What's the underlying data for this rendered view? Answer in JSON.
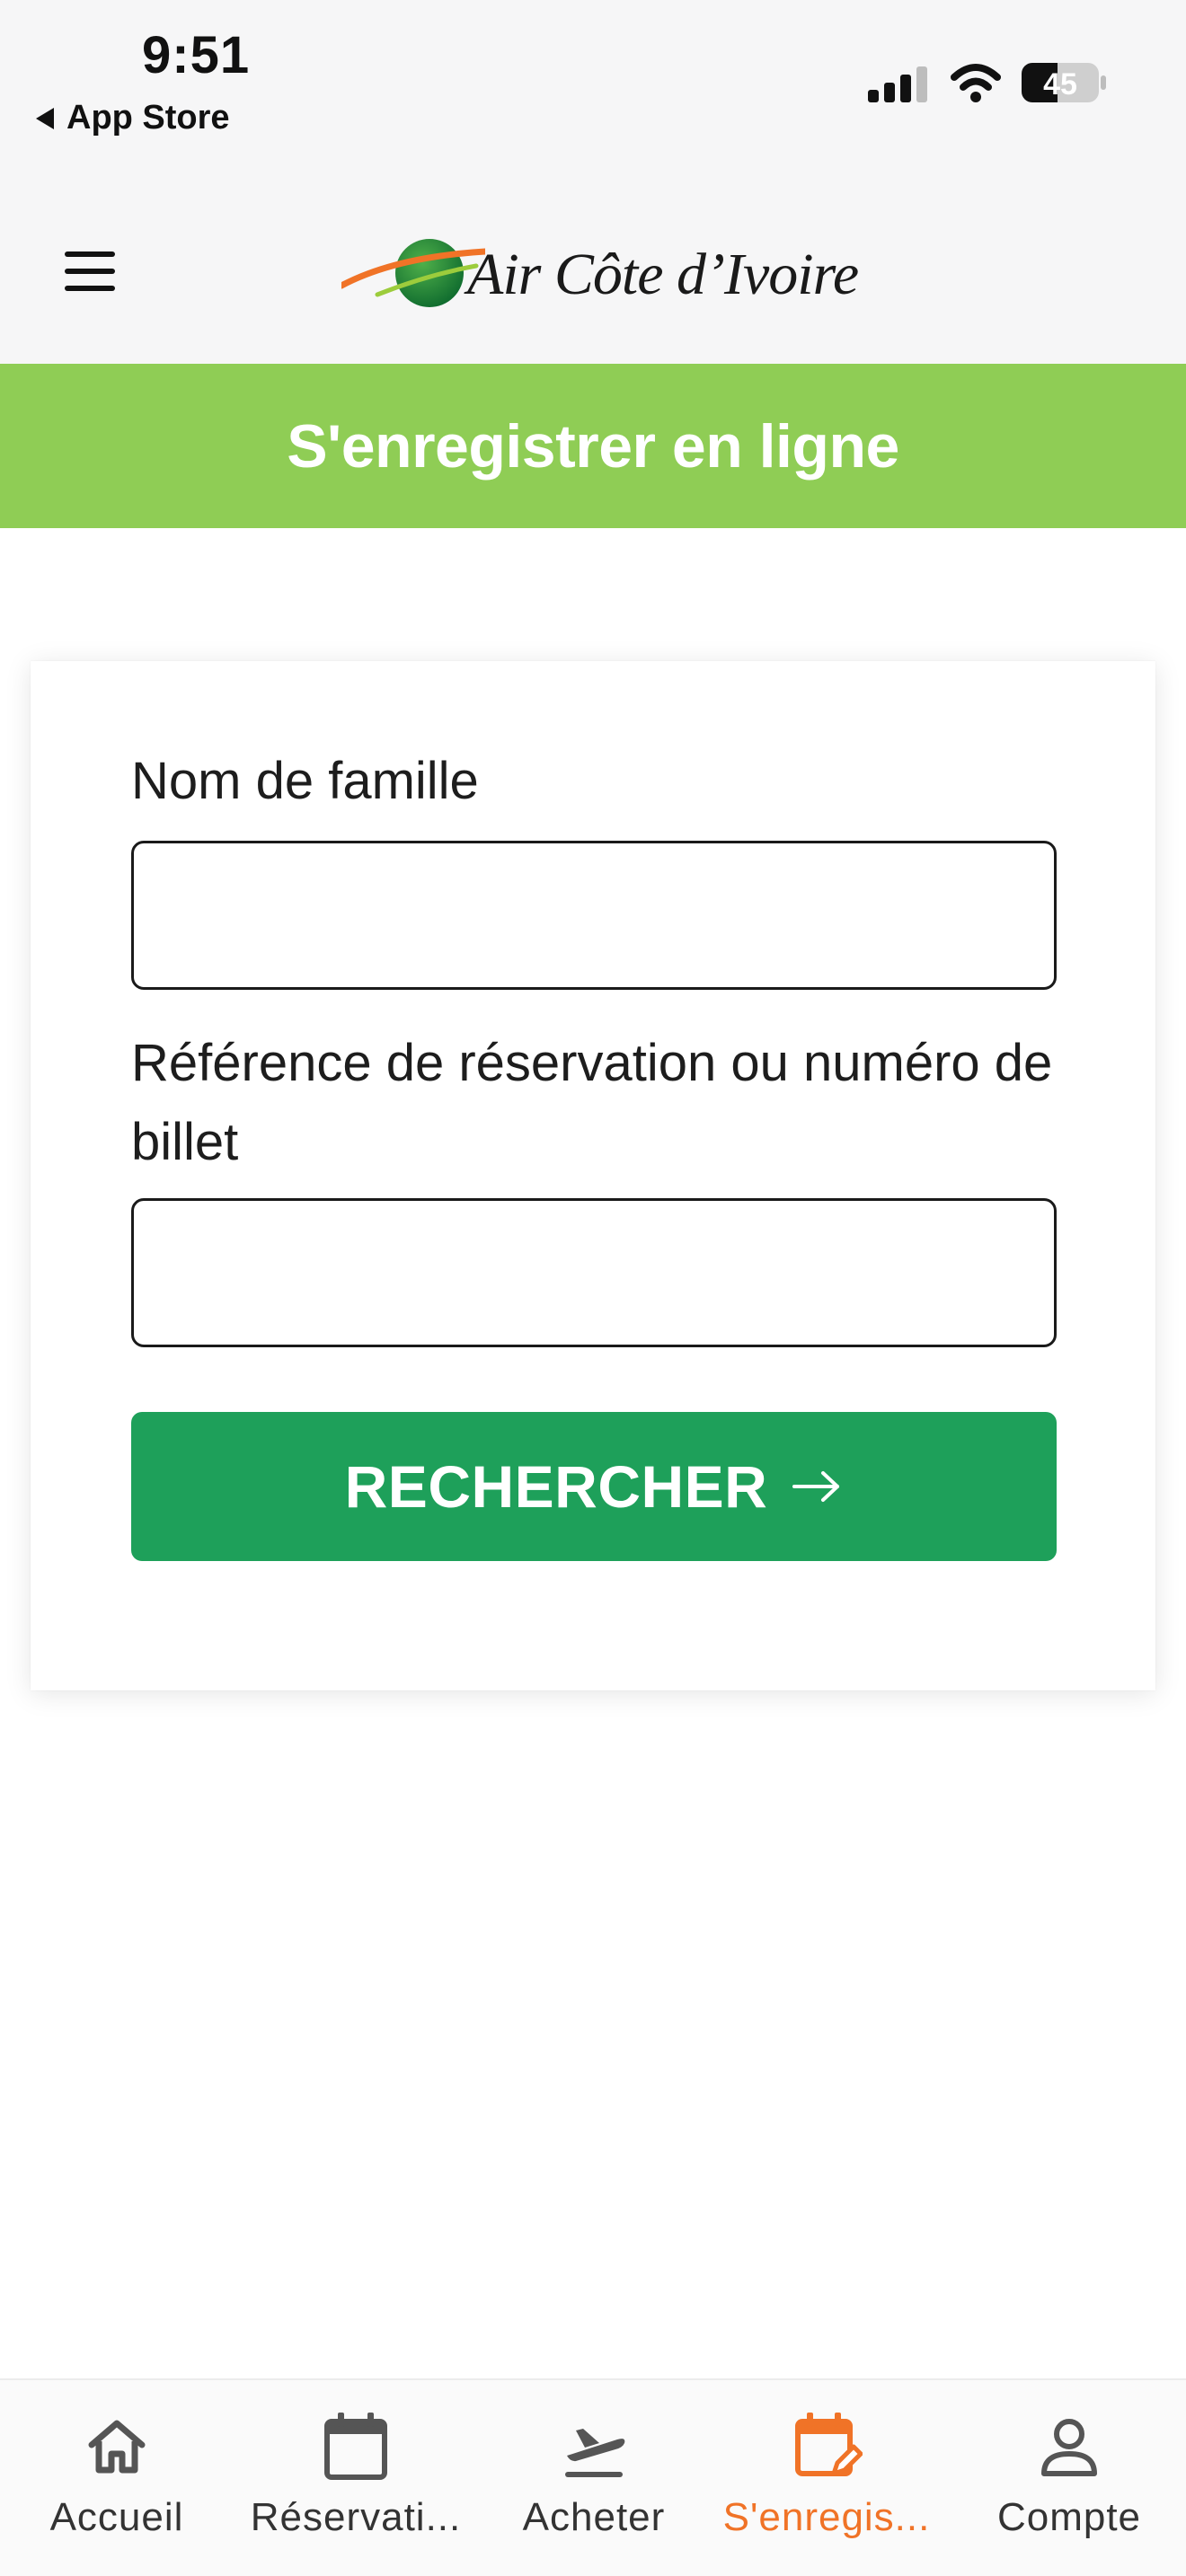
{
  "status_bar": {
    "time": "9:51",
    "back_label": "App Store",
    "battery": "45"
  },
  "header": {
    "logo_text": "Air Côte d’Ivoire",
    "menu_icon": "hamburger-icon"
  },
  "banner": {
    "title": "S'enregistrer en ligne"
  },
  "form": {
    "last_name_label": "Nom de famille",
    "last_name_value": "",
    "reference_label": "Référence de réservation ou numéro de billet",
    "reference_value": "",
    "search_button": "RECHERCHER",
    "search_button_icon": "arrow-right-icon"
  },
  "tabs": [
    {
      "label": "Accueil",
      "icon": "home-icon",
      "active": false
    },
    {
      "label": "Réservati...",
      "icon": "calendar-icon",
      "active": false
    },
    {
      "label": "Acheter",
      "icon": "plane-departure-icon",
      "active": false
    },
    {
      "label": "S'enregis...",
      "icon": "calendar-edit-icon",
      "active": true
    },
    {
      "label": "Compte",
      "icon": "user-icon",
      "active": false
    }
  ],
  "colors": {
    "banner": "#8fcd55",
    "button": "#1ea05a",
    "active_tab": "#f07327",
    "inactive_tab": "#333333"
  }
}
